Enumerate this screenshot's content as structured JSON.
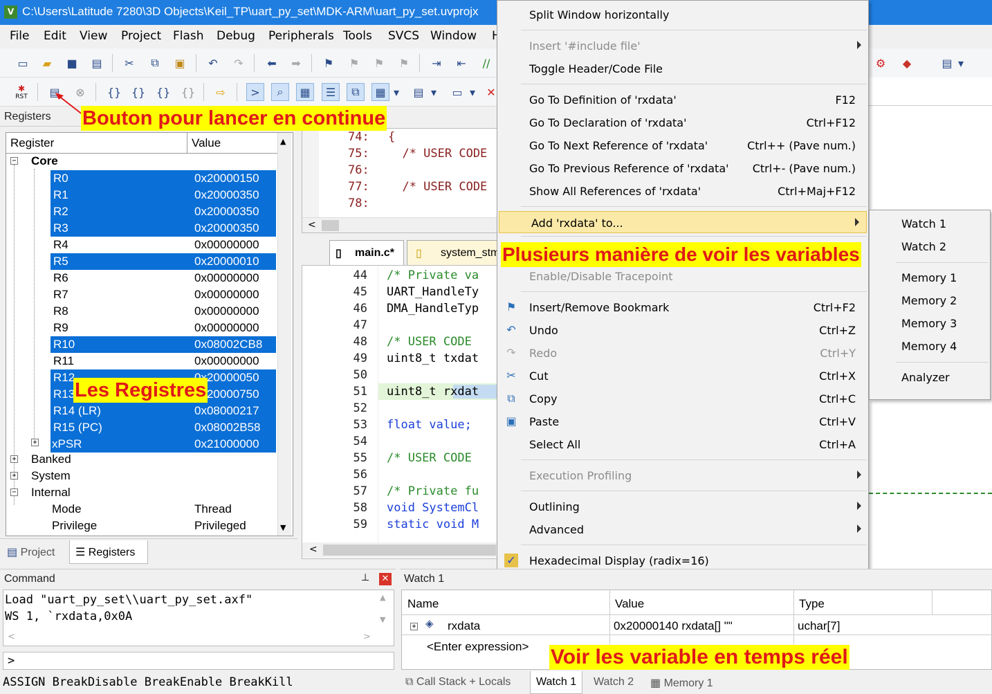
{
  "window": {
    "title": "C:\\Users\\Latitude 7280\\3D Objects\\Keil_TP\\uart_py_set\\MDK-ARM\\uart_py_set.uvprojx",
    "logo": "V"
  },
  "menubar": [
    "File",
    "Edit",
    "View",
    "Project",
    "Flash",
    "Debug",
    "Peripherals",
    "Tools",
    "SVCS",
    "Window",
    "H"
  ],
  "toolbar": {
    "rst_label": "RST"
  },
  "registers_panel": {
    "title": "Registers",
    "col_register": "Register",
    "col_value": "Value",
    "core_label": "Core",
    "rows": [
      {
        "name": "R0",
        "value": "0x20000150",
        "selected": true
      },
      {
        "name": "R1",
        "value": "0x20000350",
        "selected": true
      },
      {
        "name": "R2",
        "value": "0x20000350",
        "selected": true
      },
      {
        "name": "R3",
        "value": "0x20000350",
        "selected": true
      },
      {
        "name": "R4",
        "value": "0x00000000",
        "selected": false
      },
      {
        "name": "R5",
        "value": "0x20000010",
        "selected": true
      },
      {
        "name": "R6",
        "value": "0x00000000",
        "selected": false
      },
      {
        "name": "R7",
        "value": "0x00000000",
        "selected": false
      },
      {
        "name": "R8",
        "value": "0x00000000",
        "selected": false
      },
      {
        "name": "R9",
        "value": "0x00000000",
        "selected": false
      },
      {
        "name": "R10",
        "value": "0x08002CB8",
        "selected": true
      },
      {
        "name": "R11",
        "value": "0x00000000",
        "selected": false
      },
      {
        "name": "R12",
        "value": "0x20000050",
        "selected": true
      },
      {
        "name": "R13",
        "value": "0x20000750",
        "selected": true
      },
      {
        "name": "R14 (LR)",
        "value": "0x08000217",
        "selected": true
      },
      {
        "name": "R15 (PC)",
        "value": "0x08002B58",
        "selected": true
      },
      {
        "name": "xPSR",
        "value": "0x21000000",
        "selected": true
      }
    ],
    "groups": [
      "Banked",
      "System",
      "Internal"
    ],
    "internal": [
      {
        "name": "Mode",
        "value": "Thread"
      },
      {
        "name": "Privilege",
        "value": "Privileged"
      }
    ],
    "tabs": [
      "Project",
      "Registers"
    ]
  },
  "annotations": {
    "continuous": "Bouton pour lancer en continue",
    "registers": "Les Registres",
    "variables": "Plusieurs manière de voir les variables",
    "realtime": "Voir les variable en temps réel"
  },
  "disasm": {
    "lines": [
      {
        "ln": "74:",
        "code": "{"
      },
      {
        "ln": "75:",
        "code": "  /* USER CODE"
      },
      {
        "ln": "76:",
        "code": ""
      },
      {
        "ln": "77:",
        "code": "  /* USER CODE"
      },
      {
        "ln": "78:",
        "code": ""
      }
    ]
  },
  "editor": {
    "tabs": [
      "main.c*",
      "system_stm"
    ],
    "lines": [
      {
        "ln": "44",
        "code": "/* Private va",
        "cls": "cm"
      },
      {
        "ln": "45",
        "code": "UART_HandleTy",
        "cls": ""
      },
      {
        "ln": "46",
        "code": "DMA_HandleTyp",
        "cls": ""
      },
      {
        "ln": "47",
        "code": "",
        "cls": ""
      },
      {
        "ln": "48",
        "code": "/* USER CODE",
        "cls": "cm"
      },
      {
        "ln": "49",
        "code": "uint8_t txdat",
        "cls": ""
      },
      {
        "ln": "50",
        "code": "",
        "cls": ""
      },
      {
        "ln": "51",
        "code": "uint8_t rxdat",
        "cls": "hl51"
      },
      {
        "ln": "52",
        "code": "",
        "cls": ""
      },
      {
        "ln": "53",
        "code": "float value;",
        "cls": "kwf"
      },
      {
        "ln": "54",
        "code": "",
        "cls": ""
      },
      {
        "ln": "55",
        "code": "/* USER CODE",
        "cls": "cm"
      },
      {
        "ln": "56",
        "code": "",
        "cls": ""
      },
      {
        "ln": "57",
        "code": "/* Private fu",
        "cls": "cm"
      },
      {
        "ln": "58",
        "code": "void SystemCl",
        "cls": "kwv"
      },
      {
        "ln": "59",
        "code": "static void M",
        "cls": "kws"
      }
    ]
  },
  "context_menu": {
    "items": [
      {
        "label": "Split Window horizontally",
        "shortcut": "",
        "disabled": false
      },
      {
        "label": "Insert '#include file'",
        "shortcut": "",
        "disabled": true,
        "submenu": true
      },
      {
        "label": "Toggle Header/Code File",
        "shortcut": "",
        "disabled": false
      },
      {
        "label": "Go To Definition of 'rxdata'",
        "shortcut": "F12",
        "disabled": false
      },
      {
        "label": "Go To Declaration of 'rxdata'",
        "shortcut": "Ctrl+F12",
        "disabled": false
      },
      {
        "label": "Go To Next Reference of 'rxdata'",
        "shortcut": "Ctrl++ (Pave num.)",
        "disabled": false
      },
      {
        "label": "Go To Previous Reference of 'rxdata'",
        "shortcut": "Ctrl+- (Pave num.)",
        "disabled": false
      },
      {
        "label": "Show All References of 'rxdata'",
        "shortcut": "Ctrl+Maj+F12",
        "disabled": false
      },
      {
        "label": "Add 'rxdata' to...",
        "shortcut": "",
        "disabled": false,
        "submenu": true
      },
      {
        "label": "Enable/Disable Tracepoint",
        "shortcut": "",
        "disabled": true
      },
      {
        "label": "Insert/Remove Bookmark",
        "shortcut": "Ctrl+F2",
        "disabled": false
      },
      {
        "label": "Undo",
        "shortcut": "Ctrl+Z",
        "disabled": false
      },
      {
        "label": "Redo",
        "shortcut": "Ctrl+Y",
        "disabled": true
      },
      {
        "label": "Cut",
        "shortcut": "Ctrl+X",
        "disabled": false
      },
      {
        "label": "Copy",
        "shortcut": "Ctrl+C",
        "disabled": false
      },
      {
        "label": "Paste",
        "shortcut": "Ctrl+V",
        "disabled": false
      },
      {
        "label": "Select All",
        "shortcut": "Ctrl+A",
        "disabled": false
      },
      {
        "label": "Execution Profiling",
        "shortcut": "",
        "disabled": true,
        "submenu": true
      },
      {
        "label": "Outlining",
        "shortcut": "",
        "disabled": false,
        "submenu": true
      },
      {
        "label": "Advanced",
        "shortcut": "",
        "disabled": false,
        "submenu": true
      },
      {
        "label": "Hexadecimal Display (radix=16)",
        "shortcut": "",
        "disabled": false,
        "checked": true
      }
    ]
  },
  "submenu": [
    "Watch 1",
    "Watch 2",
    "Memory 1",
    "Memory 2",
    "Memory 3",
    "Memory 4",
    "Analyzer"
  ],
  "command": {
    "title": "Command",
    "lines": [
      "Load \"uart_py_set\\\\uart_py_set.axf\"",
      "WS 1, `rxdata,0x0A"
    ],
    "prompt": ">",
    "hint": "ASSIGN BreakDisable BreakEnable BreakKill"
  },
  "watch": {
    "title": "Watch 1",
    "col_name": "Name",
    "col_value": "Value",
    "col_type": "Type",
    "row": {
      "name": "rxdata",
      "value": "0x20000140 rxdata[] \"\"",
      "type": "uchar[7]"
    },
    "enter": "<Enter expression>",
    "tabs": [
      "Call Stack + Locals",
      "Watch 1",
      "Watch 2",
      "Memory 1"
    ]
  }
}
